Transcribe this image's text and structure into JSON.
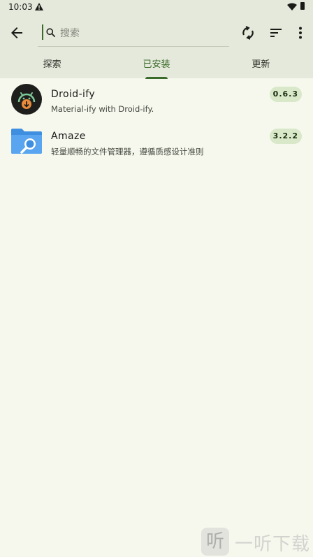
{
  "status_bar": {
    "time": "10:03"
  },
  "search": {
    "placeholder": "搜索",
    "value": ""
  },
  "tabs": [
    {
      "label": "探索",
      "active": false
    },
    {
      "label": "已安装",
      "active": true
    },
    {
      "label": "更新",
      "active": false
    }
  ],
  "apps": [
    {
      "name": "Droid-ify",
      "summary": "Material-ify with Droid-ify.",
      "version": "0.6.3"
    },
    {
      "name": "Amaze",
      "summary": "轻量顺畅的文件管理器，遵循质感设计准则",
      "version": "3.2.2"
    }
  ],
  "watermark": {
    "glyph": "听",
    "text": "一听下载"
  },
  "colors": {
    "accent": "#3b6b2a",
    "appbar": "#e5e9dc",
    "background": "#f6f8ee",
    "badge": "#d8e8c8"
  },
  "icons": [
    "back-arrow-icon",
    "search-icon",
    "sync-icon",
    "sort-icon",
    "more-vert-icon",
    "warning-icon",
    "wifi-icon",
    "battery-icon"
  ]
}
